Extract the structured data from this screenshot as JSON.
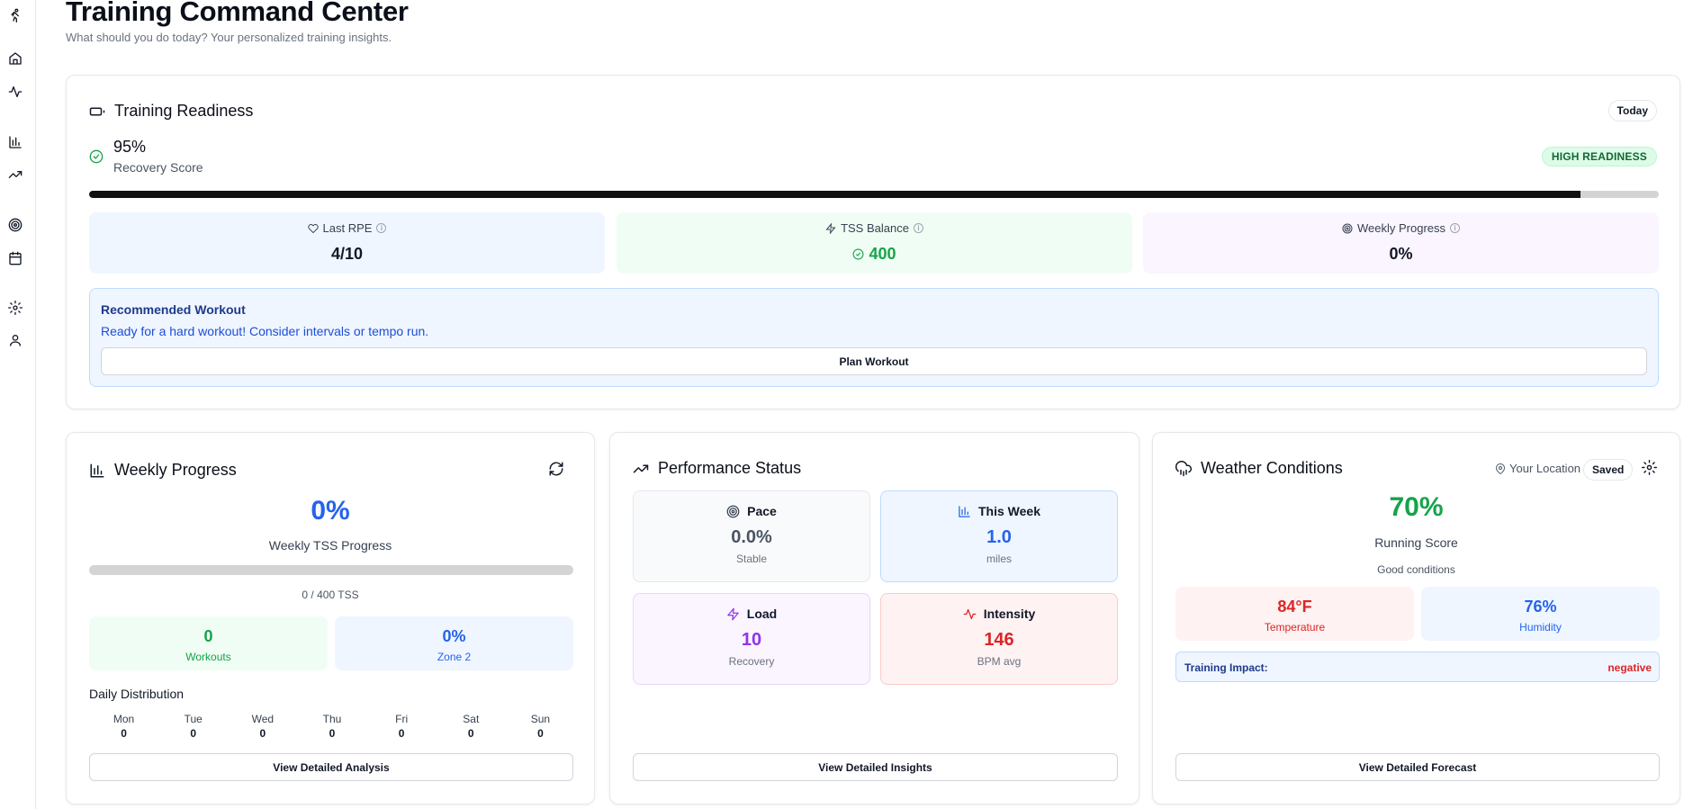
{
  "header": {
    "title": "Training Command Center",
    "subtitle": "What should you do today? Your personalized training insights."
  },
  "sidebar": {
    "icons": [
      "runner-icon",
      "home-icon",
      "activity-icon",
      "bar-chart-icon",
      "trending-up-icon",
      "target-icon",
      "calendar-icon",
      "settings-icon",
      "user-icon"
    ]
  },
  "readiness": {
    "title": "Training Readiness",
    "period_pill": "Today",
    "score": "95%",
    "score_label": "Recovery Score",
    "status_badge": "HIGH READINESS",
    "progress_fraction": 0.95,
    "stats": [
      {
        "label": "Last RPE",
        "value": "4/10",
        "icon": "heart-icon"
      },
      {
        "label": "TSS Balance",
        "value": "400",
        "icon": "zap-icon"
      },
      {
        "label": "Weekly Progress",
        "value": "0%",
        "icon": "target-icon"
      }
    ],
    "recommendation": {
      "title": "Recommended Workout",
      "text": "Ready for a hard workout! Consider intervals or tempo run.",
      "button": "Plan Workout"
    }
  },
  "weekly": {
    "title": "Weekly Progress",
    "percent": "0%",
    "percent_label": "Weekly TSS Progress",
    "progress_fraction": 0,
    "tss_text": "0 / 400 TSS",
    "workouts_value": "0",
    "workouts_label": "Workouts",
    "zone_value": "0%",
    "zone_label": "Zone 2",
    "distribution_title": "Daily Distribution",
    "days": [
      {
        "name": "Mon",
        "value": "0"
      },
      {
        "name": "Tue",
        "value": "0"
      },
      {
        "name": "Wed",
        "value": "0"
      },
      {
        "name": "Thu",
        "value": "0"
      },
      {
        "name": "Fri",
        "value": "0"
      },
      {
        "name": "Sat",
        "value": "0"
      },
      {
        "name": "Sun",
        "value": "0"
      }
    ],
    "button": "View Detailed Analysis"
  },
  "performance": {
    "title": "Performance Status",
    "boxes": [
      {
        "label": "Pace",
        "value": "0.0%",
        "sub": "Stable"
      },
      {
        "label": "This Week",
        "value": "1.0",
        "sub": "miles"
      },
      {
        "label": "Load",
        "value": "10",
        "sub": "Recovery"
      },
      {
        "label": "Intensity",
        "value": "146",
        "sub": "BPM avg"
      }
    ],
    "button": "View Detailed Insights"
  },
  "weather": {
    "title": "Weather Conditions",
    "location": "Your Location",
    "saved_pill": "Saved",
    "score": "70%",
    "score_label": "Running Score",
    "conditions": "Good conditions",
    "temperature": "84°F",
    "temperature_label": "Temperature",
    "humidity": "76%",
    "humidity_label": "Humidity",
    "impact_label": "Training Impact:",
    "impact_value": "negative",
    "button": "View Detailed Forecast"
  },
  "colors": {
    "blue": "#2563eb",
    "green": "#16a34a",
    "purple": "#9333ea",
    "red": "#dc2626"
  }
}
